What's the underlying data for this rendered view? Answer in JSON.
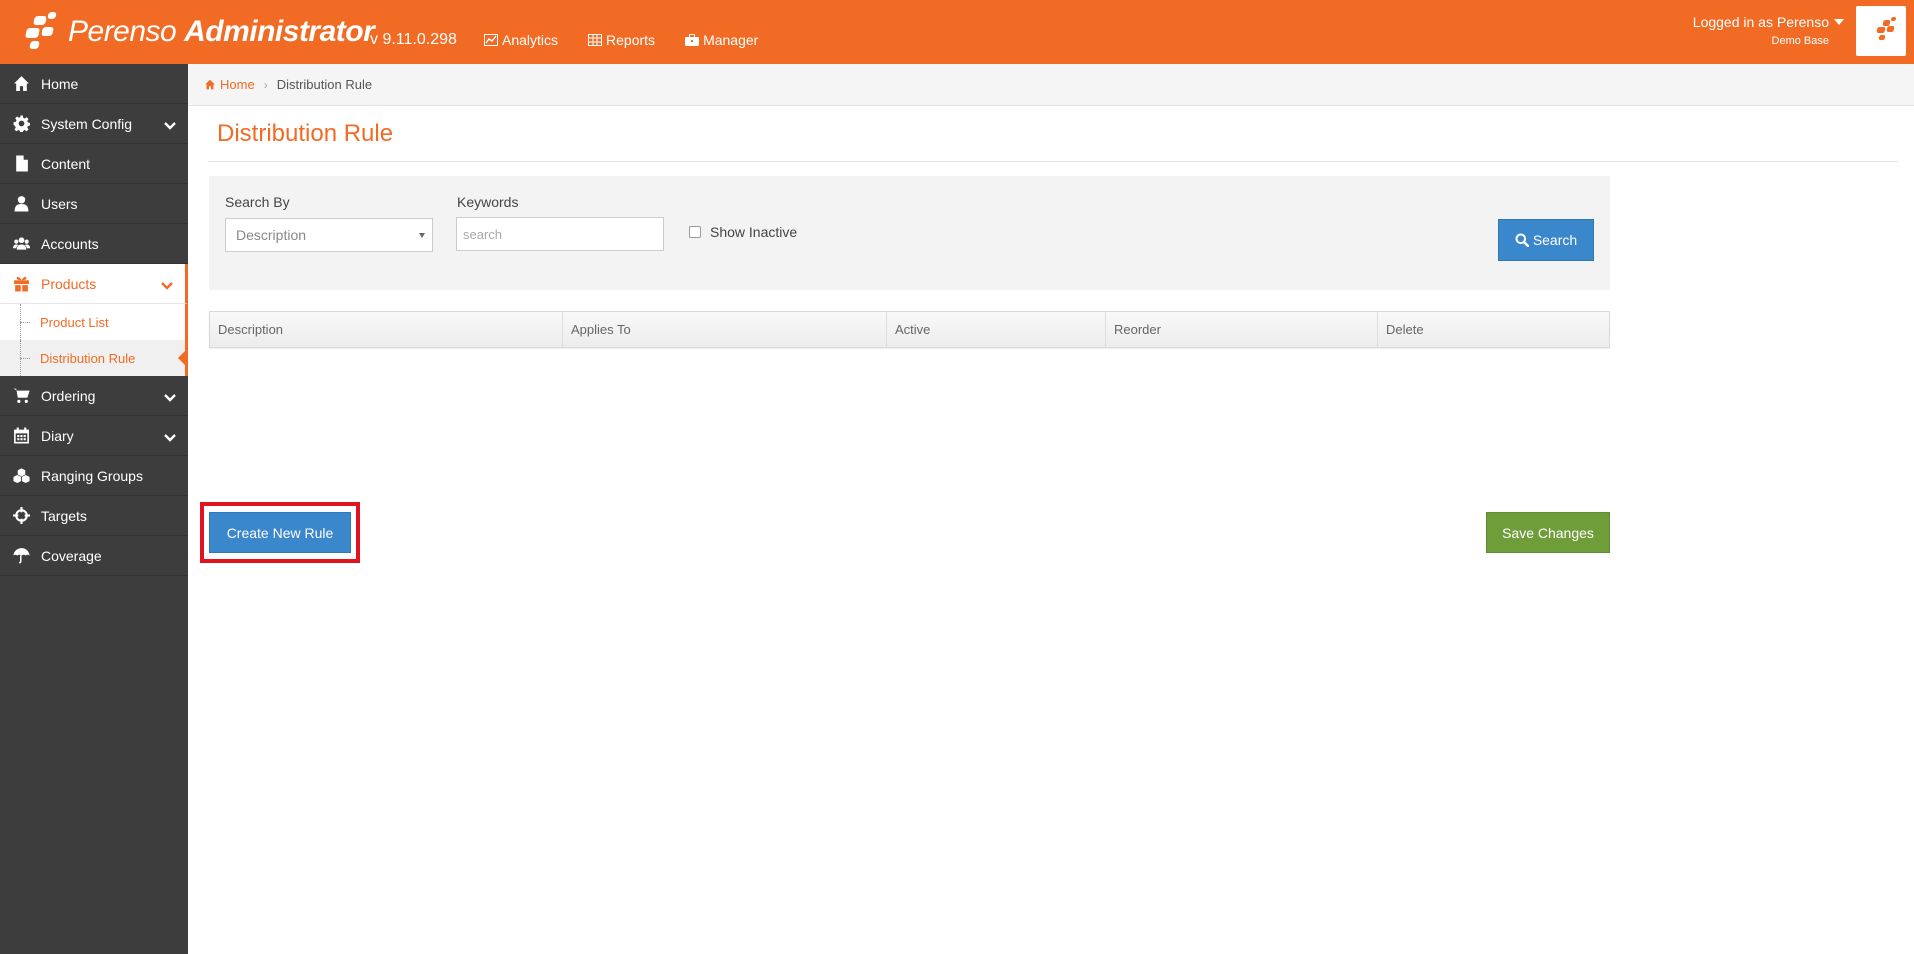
{
  "app": {
    "brand_light": "Perenso",
    "brand_bold": "Administrator",
    "version": "v 9.11.0.298",
    "accent_color": "#f26b24"
  },
  "topnav": [
    {
      "label": "Analytics",
      "icon": "chart-icon"
    },
    {
      "label": "Reports",
      "icon": "table-icon"
    },
    {
      "label": "Manager",
      "icon": "briefcase-icon"
    }
  ],
  "user": {
    "logged_in_label": "Logged in as Perenso",
    "database": "Demo Base"
  },
  "sidebar": {
    "items": [
      {
        "label": "Home",
        "icon": "home-icon"
      },
      {
        "label": "System Config",
        "icon": "gear-icon",
        "expandable": true
      },
      {
        "label": "Content",
        "icon": "file-icon"
      },
      {
        "label": "Users",
        "icon": "user-icon"
      },
      {
        "label": "Accounts",
        "icon": "users-icon"
      },
      {
        "label": "Products",
        "icon": "gift-icon",
        "expandable": true,
        "active": true
      },
      {
        "label": "Ordering",
        "icon": "cart-icon",
        "expandable": true
      },
      {
        "label": "Diary",
        "icon": "calendar-icon",
        "expandable": true
      },
      {
        "label": "Ranging Groups",
        "icon": "cubes-icon"
      },
      {
        "label": "Targets",
        "icon": "crosshairs-icon"
      },
      {
        "label": "Coverage",
        "icon": "umbrella-icon"
      }
    ],
    "products_sub": [
      {
        "label": "Product List"
      },
      {
        "label": "Distribution Rule",
        "current": true
      }
    ]
  },
  "breadcrumb": {
    "home": "Home",
    "current": "Distribution Rule"
  },
  "page": {
    "title": "Distribution Rule"
  },
  "search": {
    "search_by_label": "Search By",
    "search_by_value": "Description",
    "keywords_label": "Keywords",
    "keywords_placeholder": "search",
    "keywords_value": "",
    "show_inactive_label": "Show Inactive",
    "show_inactive_checked": false,
    "search_button": "Search"
  },
  "table": {
    "columns": [
      "Description",
      "Applies To",
      "Active",
      "Reorder",
      "Delete"
    ],
    "rows": []
  },
  "actions": {
    "create_button": "Create New Rule",
    "save_button": "Save Changes"
  }
}
